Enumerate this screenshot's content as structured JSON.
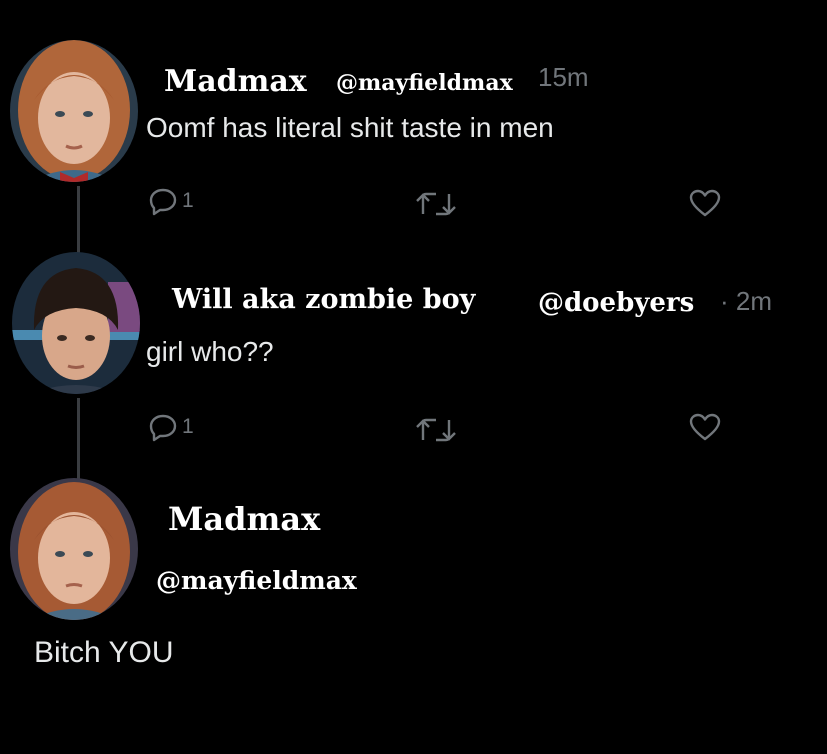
{
  "tweets": [
    {
      "name": "Madmax",
      "handle": "@mayfieldmax",
      "time": "15m",
      "text": "Oomf has literal shit taste in men",
      "reply_count": "1",
      "avatar": "red-haired-girl-avatar"
    },
    {
      "name": "Will aka zombie boy",
      "handle": "@doebyers",
      "time": "· 2m",
      "text": "girl who??",
      "reply_count": "1",
      "avatar": "bowl-cut-boy-avatar"
    },
    {
      "name": "Madmax",
      "handle": "@mayfieldmax",
      "text": "Bitch YOU",
      "avatar": "red-haired-girl-avatar"
    }
  ],
  "colors": {
    "background": "#000000",
    "primary_text": "#e7e9ea",
    "secondary_text": "#71767b",
    "thread_line": "#3a3d41"
  },
  "icons": [
    "reply-icon",
    "retweet-icon",
    "like-icon"
  ]
}
